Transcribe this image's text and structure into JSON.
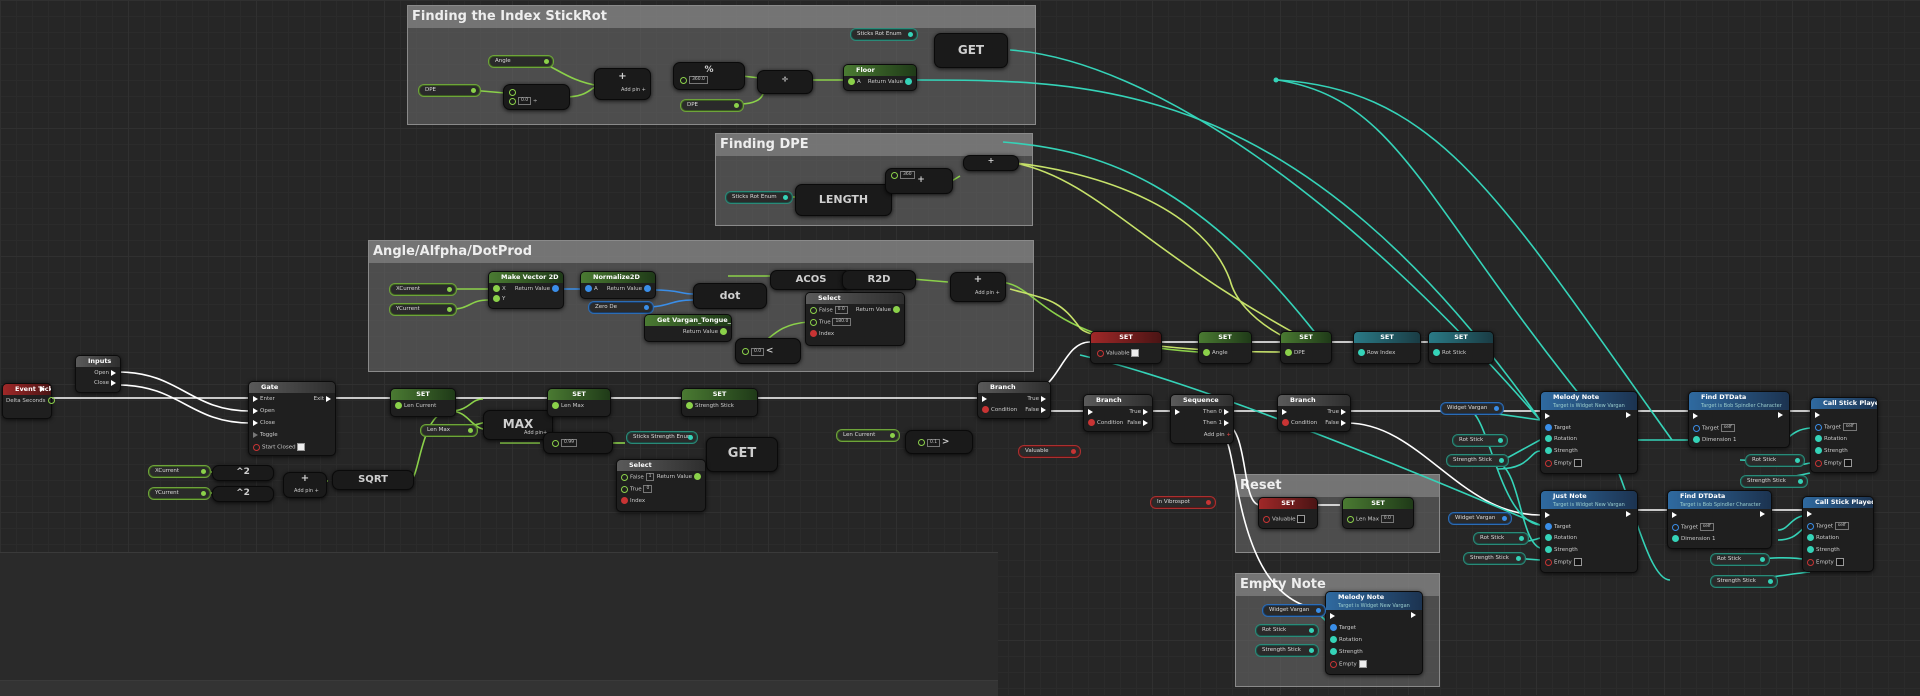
{
  "comments": {
    "finding_index": "Finding the Index StickRot",
    "finding_dpe": "Finding DPE",
    "angle_alpha": "Angle/Alfpha/DotProd",
    "reset": "Reset",
    "empty_note": "Empty Note"
  },
  "nodes": {
    "event_tick": {
      "title": "Event Tick",
      "pin": "Delta Seconds"
    },
    "inputs": {
      "title": "Inputs",
      "open": "Open",
      "close": "Close"
    },
    "gate": {
      "title": "Gate",
      "enter": "Enter",
      "open": "Open",
      "close": "Close",
      "toggle": "Toggle",
      "start_closed": "Start Closed",
      "exit": "Exit"
    },
    "set1": {
      "title": "SET",
      "pin": "Len Current"
    },
    "max": {
      "label": "MAX",
      "addpin": "Add pin",
      "lenmax": "Len Max",
      "val": "0.99"
    },
    "set2": {
      "title": "SET",
      "pin": "Len Max"
    },
    "set3": {
      "title": "SET",
      "pin": "Strength Stick"
    },
    "sqrt": {
      "label": "SQRT",
      "pow": "^2",
      "addpin": "Add pin",
      "xcurrent": "XCurrent",
      "ycurrent": "YCurrent"
    },
    "sticks_strength_enum": "Sticks Strength Enum",
    "get_strength": "GET",
    "select_strength": {
      "title": "Select",
      "false": "False",
      "true": "True",
      "index": "Index",
      "rv": "Return Value",
      "fv": "1",
      "tv": "0"
    },
    "len_current_var": "Len Current",
    "compare_val": "0.1",
    "make_vector": {
      "title": "Make Vector 2D",
      "x": "X",
      "y": "Y",
      "rv": "Return Value"
    },
    "xcurrent": "XCurrent",
    "ycurrent": "YCurrent",
    "normalize": {
      "title": "Normalize2D",
      "a": "A",
      "rv": "Return Value"
    },
    "zero_de": "Zero De",
    "dot": "dot",
    "get_vargan": {
      "title": "Get Vargan_Tongue_X",
      "rv": "Return Value"
    },
    "acos": "ACOS",
    "r2d": "R2D",
    "select_angle": {
      "title": "Select",
      "false": "False",
      "true": "True",
      "index": "Index",
      "rv": "Return Value",
      "fv": "0.0",
      "tv": "180.0"
    },
    "less_val": "0.0",
    "addpin_angle": "Add pin",
    "angle_var": "Angle",
    "dpe_var": "DPE",
    "dpe_var2": "DPE",
    "sticks_rot_enum": "Sticks Rot Enum",
    "get_rot": "GET",
    "floor": {
      "title": "Floor",
      "a": "A",
      "rv": "Return Value"
    },
    "div_val": "0.0",
    "mod_val": "360.0",
    "addpin_idx": "Add pin",
    "length": "LENGTH",
    "sticks_rot_enum2": "Sticks Rot Enum",
    "dpe_add_val": "360",
    "branch1": {
      "title": "Branch",
      "cond": "Condition",
      "t": "True",
      "f": "False"
    },
    "valuable_var": "Valuable",
    "set_valuable": {
      "title": "SET",
      "pin": "Valuable"
    },
    "set_angle": {
      "title": "SET",
      "pin": "Angle"
    },
    "set_dpe": {
      "title": "SET",
      "pin": "DPE"
    },
    "set_row": {
      "title": "SET",
      "pin": "Row Index"
    },
    "set_rot": {
      "title": "SET",
      "pin": "Rot Stick"
    },
    "branch2": {
      "title": "Branch",
      "cond": "Condition",
      "t": "True",
      "f": "False"
    },
    "sequence": {
      "title": "Sequence",
      "then0": "Then 0",
      "then1": "Then 1",
      "addpin": "Add pin"
    },
    "branch3": {
      "title": "Branch",
      "cond": "Condition",
      "t": "True",
      "f": "False"
    },
    "in_vibrospot": "In Vibrospot",
    "reset_set1": {
      "title": "SET",
      "pin": "Valuable"
    },
    "reset_set2": {
      "title": "SET",
      "pin": "Len Max",
      "val": "0.0"
    },
    "melody_note1": {
      "title": "Melody Note",
      "sub": "Target is Widget New Vargan",
      "target": "Target",
      "rotation": "Rotation",
      "strength": "Strength",
      "empty": "Empty"
    },
    "just_note": {
      "title": "Just Note",
      "sub": "Target is Widget New Vargan",
      "target": "Target",
      "rotation": "Rotation",
      "strength": "Strength",
      "empty": "Empty"
    },
    "melody_note2": {
      "title": "Melody Note",
      "sub": "Target is Widget New Vargan",
      "target": "Target",
      "rotation": "Rotation",
      "strength": "Strength",
      "empty": "Empty"
    },
    "widget_vargan1": "Widget Vargan",
    "widget_vargan2": "Widget Vargan",
    "widget_vargan3": "Widget Vargan",
    "rot_stick1": "Rot Stick",
    "rot_stick2": "Rot Stick",
    "rot_stick3": "Rot Stick",
    "rot_stick4": "Rot Stick",
    "rot_stick5": "Rot Stick",
    "strength_stick1": "Strength Stick",
    "strength_stick2": "Strength Stick",
    "strength_stick3": "Strength Stick",
    "strength_stick4": "Strength Stick",
    "strength_stick5": "Strength Stick",
    "find_dt1": {
      "title": "Find DTData",
      "sub": "Target is Bob Spindler Character",
      "target": "Target",
      "self": "self",
      "dim": "Dimension 1"
    },
    "find_dt2": {
      "title": "Find DTData",
      "sub": "Target is Bob Spindler Character",
      "target": "Target",
      "self": "self",
      "dim": "Dimension 1"
    },
    "call_stick1": {
      "title": "Call Stick Played",
      "target": "Target",
      "self": "self",
      "rotation": "Rotation",
      "strength": "Strength",
      "empty": "Empty"
    },
    "call_stick2": {
      "title": "Call Stick Played",
      "target": "Target",
      "self": "self",
      "rotation": "Rotation",
      "strength": "Strength",
      "empty": "Empty"
    },
    "angle_getter": "Angle",
    "dpe_getter": "DPE"
  },
  "colors": {
    "exec": "#ffffff",
    "float": "#8bd14a",
    "struct": "#3a8ee8",
    "object": "#35d3b8",
    "bool": "#c83434"
  }
}
